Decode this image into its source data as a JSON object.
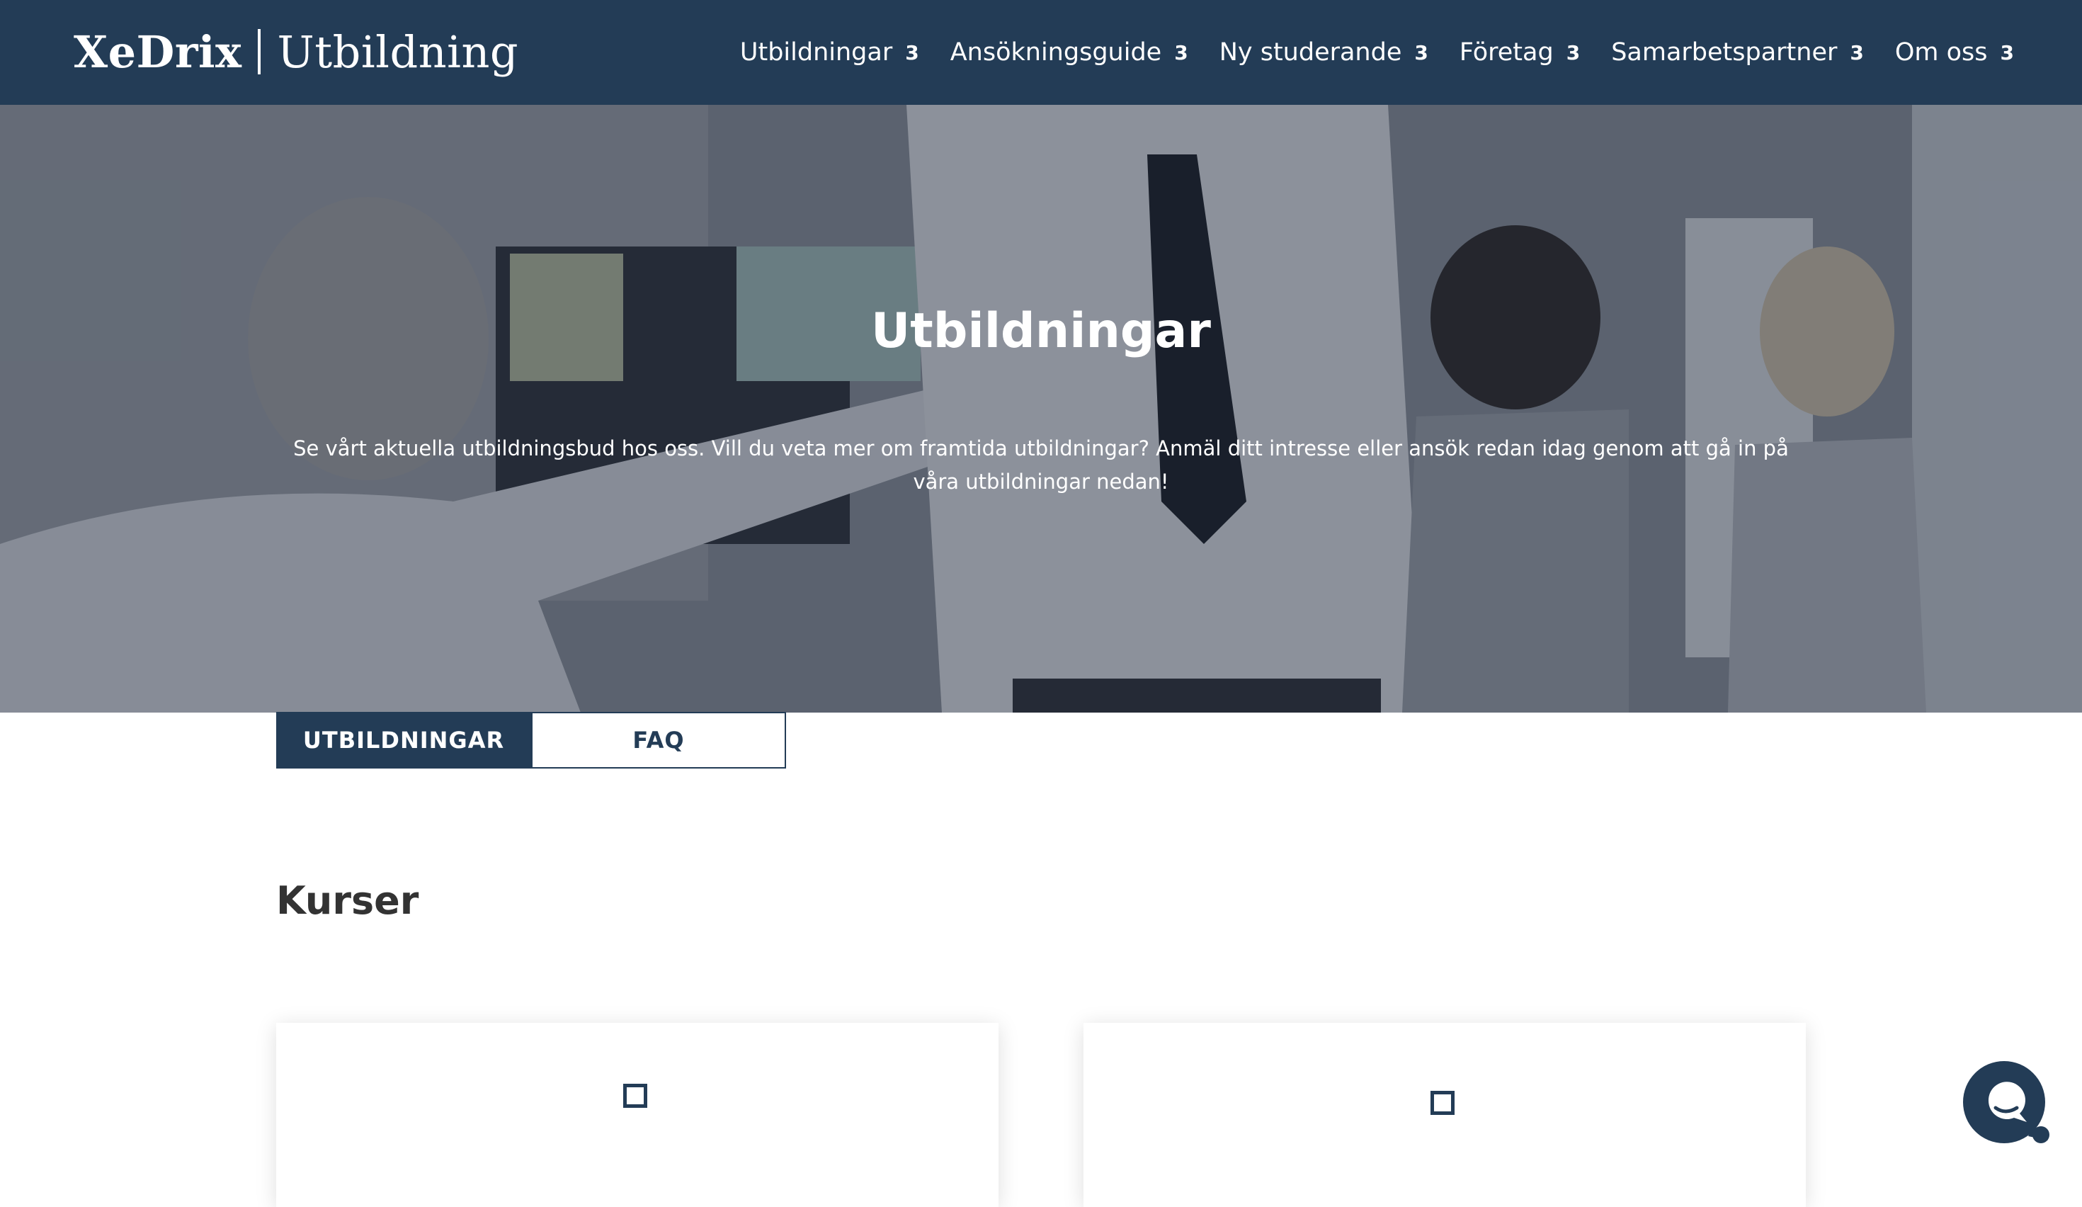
{
  "header": {
    "logo": {
      "brand": "XeDrix",
      "sub": "Utbildning"
    },
    "nav": [
      {
        "label": "Utbildningar",
        "chevron": "3"
      },
      {
        "label": "Ansökningsguide",
        "chevron": "3"
      },
      {
        "label": "Ny studerande",
        "chevron": "3"
      },
      {
        "label": "Företag",
        "chevron": "3"
      },
      {
        "label": "Samarbetspartner",
        "chevron": "3"
      },
      {
        "label": "Om oss",
        "chevron": "3"
      }
    ]
  },
  "hero": {
    "title": "Utbildningar",
    "lead": "Se vårt aktuella utbildningsbud hos oss. Vill du veta mer om framtida utbildningar? Anmäl ditt intresse eller ansök redan idag genom att gå in på våra utbildningar nedan!"
  },
  "tabs": [
    {
      "label": "UTBILDNINGAR",
      "active": true
    },
    {
      "label": "FAQ",
      "active": false
    }
  ],
  "section": {
    "title": "Kurser"
  },
  "cards": [
    {
      "icon": "square-icon",
      "title": ""
    },
    {
      "icon": "square-icon",
      "title": ""
    }
  ],
  "chat": {
    "icon": "chat-bubble-icon"
  },
  "colors": {
    "brand": "#233c56",
    "white": "#ffffff",
    "text": "#333333"
  }
}
